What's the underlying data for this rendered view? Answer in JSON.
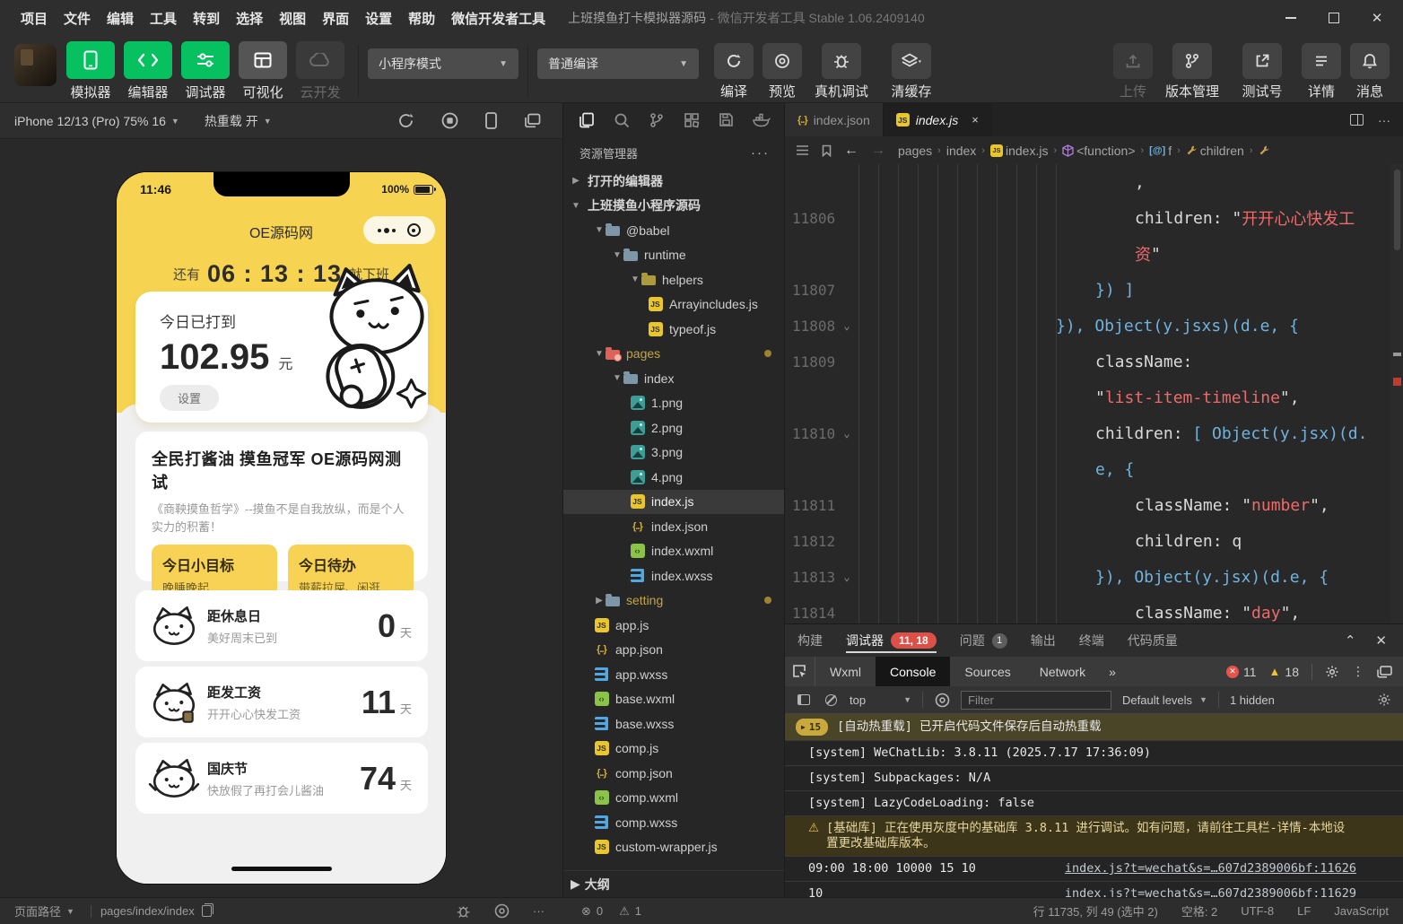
{
  "titlebar": {
    "menus": [
      "项目",
      "文件",
      "编辑",
      "工具",
      "转到",
      "选择",
      "视图",
      "界面",
      "设置",
      "帮助",
      "微信开发者工具"
    ],
    "project_title": "上班摸鱼打卡模拟器源码",
    "app_title": "- 微信开发者工具 Stable 1.06.2409140"
  },
  "toolbar": {
    "buttons": [
      {
        "label": "模拟器",
        "icon": "phone-icon"
      },
      {
        "label": "编辑器",
        "icon": "code-icon"
      },
      {
        "label": "调试器",
        "icon": "sliders-icon"
      },
      {
        "label": "可视化",
        "icon": "layout-icon"
      },
      {
        "label": "云开发",
        "icon": "cloud-icon"
      }
    ],
    "mode_select": "小程序模式",
    "compile_select": "普通编译",
    "actions": [
      {
        "label": "编译",
        "icon": "refresh-icon"
      },
      {
        "label": "预览",
        "icon": "eye-icon"
      },
      {
        "label": "真机调试",
        "icon": "bug-icon"
      },
      {
        "label": "清缓存",
        "icon": "layers-icon"
      }
    ],
    "right_actions": [
      {
        "label": "上传",
        "icon": "upload-icon"
      },
      {
        "label": "版本管理",
        "icon": "branch-icon"
      },
      {
        "label": "测试号",
        "icon": "external-icon"
      },
      {
        "label": "详情",
        "icon": "menu-icon"
      },
      {
        "label": "消息",
        "icon": "bell-icon"
      }
    ]
  },
  "simulator": {
    "device": "iPhone 12/13 (Pro) 75% 16",
    "hot_reload": "热重载 开"
  },
  "phone": {
    "time": "11:46",
    "battery": "100%",
    "nav_title": "OE源码网",
    "countdown_prefix": "还有",
    "countdown_time": "06 : 13 : 13",
    "countdown_suffix": "就下班",
    "earn_label": "今日已打到",
    "earn_value": "102.95",
    "earn_unit": "元",
    "settings_btn": "设置",
    "banner_title": "全民打酱油 摸鱼冠军 OE源码网测试",
    "banner_desc": "《商鞅摸鱼哲学》--摸鱼不是自我放纵，而是个人实力的积蓄！",
    "goal": {
      "title": "今日小目标",
      "desc": "晚睡晚起"
    },
    "todo": {
      "title": "今日待办",
      "desc": "带薪拉屎、闲逛"
    },
    "timeline": [
      {
        "title": "距休息日",
        "desc": "美好周末已到",
        "days": "0",
        "unit": "天"
      },
      {
        "title": "距发工资",
        "desc": "开开心心快发工资",
        "days": "11",
        "unit": "天"
      },
      {
        "title": "国庆节",
        "desc": "快放假了再打会儿酱油",
        "days": "74",
        "unit": "天"
      }
    ]
  },
  "explorer": {
    "header": "资源管理器",
    "open_editors": "打开的编辑器",
    "project": "上班摸鱼小程序源码",
    "outline": "大纲",
    "tree": [
      {
        "label": "@babel",
        "icon": "folder-icon"
      },
      {
        "label": "runtime",
        "icon": "folder-icon"
      },
      {
        "label": "helpers",
        "icon": "folder-icon"
      },
      {
        "label": "Arrayincludes.js",
        "icon": "js-file-icon"
      },
      {
        "label": "typeof.js",
        "icon": "js-file-icon"
      },
      {
        "label": "pages",
        "icon": "folder-error-icon"
      },
      {
        "label": "index",
        "icon": "folder-icon"
      },
      {
        "label": "1.png",
        "icon": "image-file-icon"
      },
      {
        "label": "2.png",
        "icon": "image-file-icon"
      },
      {
        "label": "3.png",
        "icon": "image-file-icon"
      },
      {
        "label": "4.png",
        "icon": "image-file-icon"
      },
      {
        "label": "index.js",
        "icon": "js-file-icon"
      },
      {
        "label": "index.json",
        "icon": "json-file-icon"
      },
      {
        "label": "index.wxml",
        "icon": "wxml-file-icon"
      },
      {
        "label": "index.wxss",
        "icon": "wxss-file-icon"
      },
      {
        "label": "setting",
        "icon": "folder-icon"
      },
      {
        "label": "app.js",
        "icon": "js-file-icon"
      },
      {
        "label": "app.json",
        "icon": "json-file-icon"
      },
      {
        "label": "app.wxss",
        "icon": "wxss-file-icon"
      },
      {
        "label": "base.wxml",
        "icon": "wxml-file-icon"
      },
      {
        "label": "base.wxss",
        "icon": "wxss-file-icon"
      },
      {
        "label": "comp.js",
        "icon": "js-file-icon"
      },
      {
        "label": "comp.json",
        "icon": "json-file-icon"
      },
      {
        "label": "comp.wxml",
        "icon": "wxml-file-icon"
      },
      {
        "label": "comp.wxss",
        "icon": "wxss-file-icon"
      },
      {
        "label": "custom-wrapper.js",
        "icon": "js-file-icon"
      }
    ]
  },
  "editor": {
    "tabs": [
      {
        "label": "index.json",
        "icon": "json-file-icon"
      },
      {
        "label": "index.js",
        "icon": "js-file-icon",
        "close": "×"
      }
    ],
    "breadcrumb": {
      "items": [
        "pages",
        "index",
        "index.js",
        "<function>",
        "f",
        "children"
      ]
    },
    "code": {
      "rows": [
        {
          "num": "",
          "tokens": [
            {
              "c": "w",
              "t": ","
            }
          ]
        },
        {
          "num": "11806",
          "tokens": [
            {
              "c": "w",
              "t": "children: \""
            },
            {
              "c": "r",
              "t": "开开心心快发工"
            }
          ]
        },
        {
          "num": "",
          "tokens": [
            {
              "c": "r",
              "t": "资"
            },
            {
              "c": "w",
              "t": "\""
            }
          ]
        },
        {
          "num": "11807",
          "tokens": [
            {
              "c": "b",
              "t": "}) ]"
            }
          ]
        },
        {
          "num": "11808",
          "tokens": [
            {
              "c": "b",
              "t": "}), Object(y.jsxs)(d.e, {"
            }
          ]
        },
        {
          "num": "11809",
          "tokens": [
            {
              "c": "w",
              "t": "className:"
            }
          ]
        },
        {
          "num": "",
          "tokens": [
            {
              "c": "w",
              "t": "\""
            },
            {
              "c": "r",
              "t": "list-item-timeline"
            },
            {
              "c": "w",
              "t": "\","
            }
          ]
        },
        {
          "num": "11810",
          "tokens": [
            {
              "c": "w",
              "t": "children: "
            },
            {
              "c": "b",
              "t": "[ Object(y.jsx)(d."
            }
          ]
        },
        {
          "num": "",
          "tokens": [
            {
              "c": "b",
              "t": "e, {"
            }
          ]
        },
        {
          "num": "11811",
          "tokens": [
            {
              "c": "w",
              "t": "className: \""
            },
            {
              "c": "r",
              "t": "number"
            },
            {
              "c": "w",
              "t": "\","
            }
          ]
        },
        {
          "num": "11812",
          "tokens": [
            {
              "c": "w",
              "t": "children: q"
            }
          ]
        },
        {
          "num": "11813",
          "tokens": [
            {
              "c": "b",
              "t": "}), Object(y.jsx)(d.e, {"
            }
          ]
        },
        {
          "num": "11814",
          "tokens": [
            {
              "c": "w",
              "t": "className: \""
            },
            {
              "c": "r",
              "t": "day"
            },
            {
              "c": "w",
              "t": "\","
            }
          ]
        }
      ]
    }
  },
  "debugger": {
    "tabs": [
      "构建",
      "调试器",
      "问题",
      "输出",
      "终端",
      "代码质量"
    ],
    "debug_badge": "11, 18",
    "problem_badge": "1",
    "devtools_tabs": [
      "Wxml",
      "Console",
      "Sources",
      "Network"
    ],
    "overflow": "»",
    "error_count": "11",
    "warning_count": "18",
    "console_toolbar": {
      "context": "top",
      "filter_placeholder": "Filter",
      "levels": "Default levels",
      "hidden": "1 hidden"
    },
    "console_rows": [
      {
        "type": "group",
        "badge": "15",
        "text": "[自动热重载] 已开启代码文件保存后自动热重载"
      },
      {
        "type": "info",
        "text": "[system] WeChatLib: 3.8.11 (2025.7.17 17:36:09)"
      },
      {
        "type": "info",
        "text": "[system] Subpackages: N/A"
      },
      {
        "type": "info",
        "text": "[system] LazyCodeLoading: false"
      },
      {
        "type": "warn",
        "text": "[基础库] 正在使用灰度中的基础库 3.8.11 进行调试。如有问题，请前往工具栏-详情-本地设置更改基础库版本。"
      },
      {
        "type": "log",
        "text": "09:00 18:00 10000 15 10",
        "link": "index.js?t=wechat&s=…607d2389006bf:11626"
      },
      {
        "type": "log",
        "text": "10",
        "link": "index.js?t=wechat&s=…607d2389006bf:11629"
      }
    ]
  },
  "statusbar": {
    "page_path_label": "页面路径",
    "page_path": "pages/index/index",
    "error_count": "0",
    "warning_count": "1",
    "right": [
      "行 11735, 列 49 (选中 2)",
      "空格: 2",
      "UTF-8",
      "LF",
      "JavaScript"
    ]
  },
  "colors": {
    "brand_green": "#07c160",
    "phone_yellow": "#f6d451",
    "error_red": "#dd5048",
    "warning_yellow": "#f2c12e"
  }
}
